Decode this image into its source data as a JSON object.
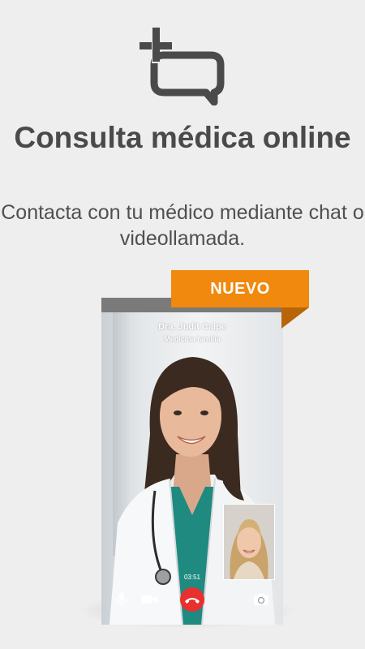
{
  "header": {
    "logo_icon": "chat-plus-icon",
    "title": "Consulta médica online",
    "subtitle": "Contacta con tu médico mediante chat o videollamada."
  },
  "badge": {
    "label": "NUEVO"
  },
  "call": {
    "doctor_name": "Dra. Judit Calpe",
    "specialty": "Medicina familia",
    "timer": "03:51",
    "controls": [
      "microphone-icon",
      "video-camera-icon",
      "hang-up-icon",
      "switch-camera-icon"
    ]
  },
  "colors": {
    "background": "#eeeeee",
    "text": "#4a4a4a",
    "accent": "#f0890d",
    "hangup": "#e8302f"
  }
}
